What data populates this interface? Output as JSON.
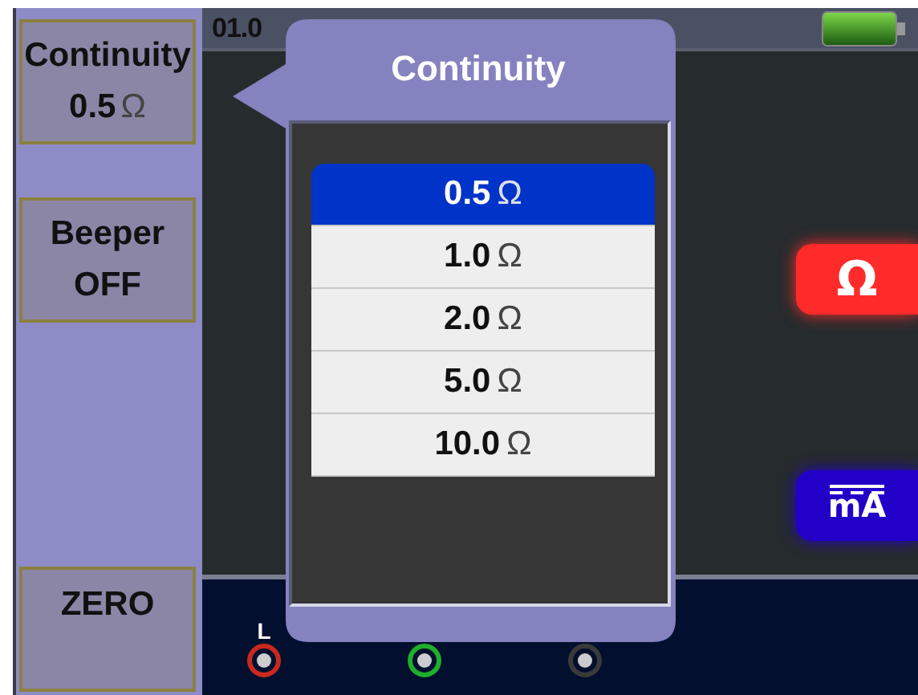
{
  "softkeys": [
    {
      "label": "Continuity",
      "value": "0.5",
      "unit": "Ω"
    },
    {
      "label": "Beeper",
      "value": "OFF"
    },
    {
      "label": "ZERO"
    }
  ],
  "status_bar": {
    "date": "01.0"
  },
  "mode_badges": [
    {
      "kind": "resistance",
      "symbol": "Ω",
      "color": "#ff2b2b"
    },
    {
      "kind": "dc-current",
      "symbol": "mA",
      "color": "#2300c8"
    }
  ],
  "terminals": [
    {
      "label": "L",
      "color": "#c8281e"
    },
    {
      "color": "#1fae2a"
    },
    {
      "color": "#3a3a3a"
    }
  ],
  "popup": {
    "title": "Continuity",
    "options": [
      {
        "value": "0.5",
        "unit": "Ω",
        "selected": true
      },
      {
        "value": "1.0",
        "unit": "Ω",
        "selected": false
      },
      {
        "value": "2.0",
        "unit": "Ω",
        "selected": false
      },
      {
        "value": "5.0",
        "unit": "Ω",
        "selected": false
      },
      {
        "value": "10.0",
        "unit": "Ω",
        "selected": false
      }
    ]
  }
}
